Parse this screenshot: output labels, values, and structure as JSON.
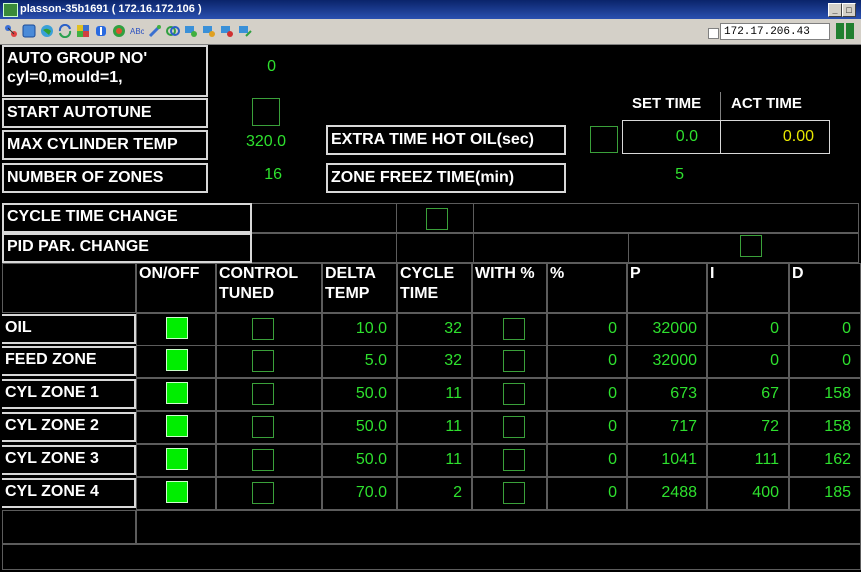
{
  "window": {
    "title": "plasson-35b1691 ( 172.16.172.106 )"
  },
  "toolbar": {
    "ip_value": "172.17.206.43",
    "icons": [
      "network-icon",
      "window-icon",
      "globe-icon",
      "refresh-icon",
      "colors-icon",
      "book-icon",
      "chat-icon",
      "text-abc-icon",
      "tools-icon",
      "connect-icon",
      "screen-icon",
      "screen-icon",
      "screen-icon",
      "screen-icon"
    ]
  },
  "params": {
    "auto_group_line1": "AUTO GROUP NO'",
    "auto_group_line2": "cyl=0,mould=1,",
    "auto_group_value": "0",
    "start_autotune": "START AUTOTUNE",
    "max_cyl_temp": "MAX CYLINDER TEMP",
    "max_cyl_temp_value": "320.0",
    "num_zones": "NUMBER OF ZONES",
    "num_zones_value": "16",
    "extra_time": "EXTRA TIME HOT OIL(sec)",
    "zone_freez": "ZONE FREEZ TIME(min)",
    "zone_freez_value": "5",
    "set_time_header": "SET TIME",
    "act_time_header": "ACT TIME",
    "set_time_value": "0.0",
    "act_time_value": "0.00",
    "cycle_time_change": "CYCLE TIME CHANGE",
    "pid_par_change": "PID PAR. CHANGE"
  },
  "colors": {
    "value_green": "#2ee02e",
    "act_yellow": "#e8e800",
    "lit_green": "#00ee00"
  },
  "table": {
    "headers": [
      "ON/OFF",
      "CONTROL\nTUNED",
      "DELTA\nTEMP",
      "CYCLE\nTIME",
      "WITH %",
      "%",
      "P",
      "I",
      "D"
    ],
    "rows": [
      {
        "name": "OIL",
        "on": true,
        "delta": "10.0",
        "cycle": "32",
        "pct": "0",
        "p": "32000",
        "i": "0",
        "d": "0"
      },
      {
        "name": "FEED ZONE",
        "on": true,
        "delta": "5.0",
        "cycle": "32",
        "pct": "0",
        "p": "32000",
        "i": "0",
        "d": "0"
      },
      {
        "name": "CYL ZONE 1",
        "on": true,
        "delta": "50.0",
        "cycle": "11",
        "pct": "0",
        "p": "673",
        "i": "67",
        "d": "158"
      },
      {
        "name": "CYL ZONE 2",
        "on": true,
        "delta": "50.0",
        "cycle": "11",
        "pct": "0",
        "p": "717",
        "i": "72",
        "d": "158"
      },
      {
        "name": "CYL ZONE 3",
        "on": true,
        "delta": "50.0",
        "cycle": "11",
        "pct": "0",
        "p": "1041",
        "i": "111",
        "d": "162"
      },
      {
        "name": "CYL ZONE 4",
        "on": true,
        "delta": "70.0",
        "cycle": "2",
        "pct": "0",
        "p": "2488",
        "i": "400",
        "d": "185"
      }
    ]
  }
}
